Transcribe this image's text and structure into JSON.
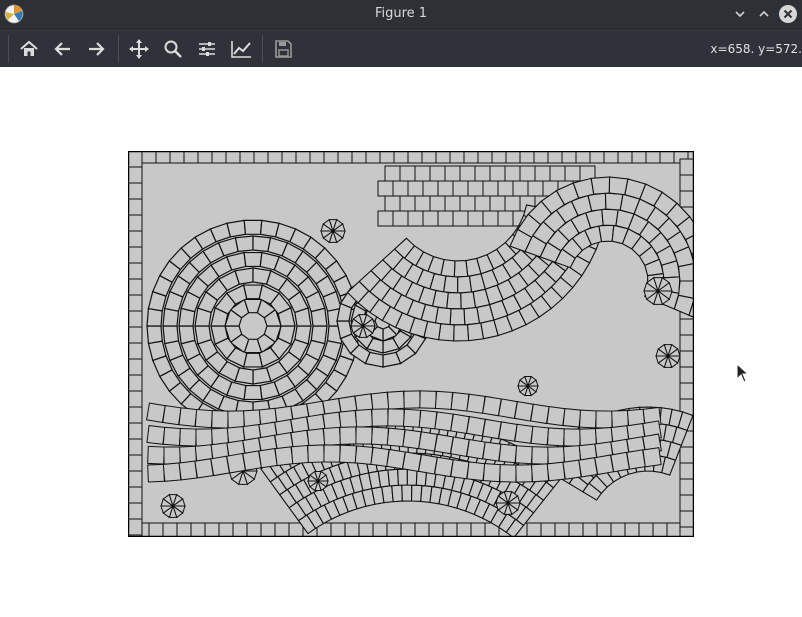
{
  "window": {
    "title": "Figure 1",
    "controls": [
      "minimize-icon",
      "maximize-icon",
      "close-icon"
    ]
  },
  "toolbar": {
    "buttons": [
      {
        "name": "home",
        "icon": "home-icon"
      },
      {
        "name": "back",
        "icon": "arrow-left-icon"
      },
      {
        "name": "forward",
        "icon": "arrow-right-icon"
      },
      {
        "name": "pan",
        "icon": "move-icon"
      },
      {
        "name": "zoom",
        "icon": "magnifier-icon"
      },
      {
        "name": "configure-subplots",
        "icon": "sliders-icon"
      },
      {
        "name": "edit-axes",
        "icon": "line-chart-icon"
      },
      {
        "name": "save",
        "icon": "floppy-disk-icon"
      }
    ],
    "coordinates": "x=658. y=572."
  },
  "figure": {
    "description_colors": {
      "tile_fill": "#c8c8c8",
      "tile_stroke": "#111111",
      "background": "#ffffff"
    }
  }
}
